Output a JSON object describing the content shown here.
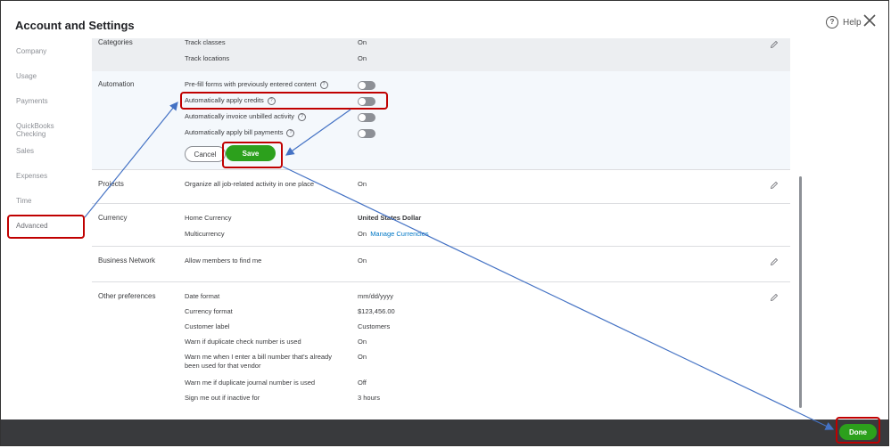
{
  "header": {
    "title": "Account and Settings",
    "help_label": "Help",
    "help_icon": "?"
  },
  "sidebar": {
    "items": [
      {
        "label": "Company"
      },
      {
        "label": "Usage"
      },
      {
        "label": "Payments"
      },
      {
        "label": "QuickBooks Checking"
      },
      {
        "label": "Sales"
      },
      {
        "label": "Expenses"
      },
      {
        "label": "Time"
      },
      {
        "label": "Advanced"
      }
    ]
  },
  "sections": {
    "categories": {
      "label": "Categories",
      "items": [
        {
          "label": "Track classes",
          "value": "On"
        },
        {
          "label": "Track locations",
          "value": "On"
        }
      ]
    },
    "automation": {
      "label": "Automation",
      "items": [
        {
          "label": "Pre-fill forms with previously entered content",
          "state": "off"
        },
        {
          "label": "Automatically apply credits",
          "state": "off"
        },
        {
          "label": "Automatically invoice unbilled activity",
          "state": "off"
        },
        {
          "label": "Automatically apply bill payments",
          "state": "off"
        }
      ],
      "cancel_label": "Cancel",
      "save_label": "Save"
    },
    "projects": {
      "label": "Projects",
      "item": {
        "label": "Organize all job-related activity in one place",
        "value": "On"
      }
    },
    "currency": {
      "label": "Currency",
      "items": [
        {
          "label": "Home Currency",
          "value": "United States Dollar"
        },
        {
          "label": "Multicurrency",
          "value": "On",
          "link": "Manage Currencies"
        }
      ]
    },
    "business_network": {
      "label": "Business Network",
      "item": {
        "label": "Allow members to find me",
        "value": "On"
      }
    },
    "other_preferences": {
      "label": "Other preferences",
      "items": [
        {
          "label": "Date format",
          "value": "mm/dd/yyyy"
        },
        {
          "label": "Currency format",
          "value": "$123,456.00"
        },
        {
          "label": "Customer label",
          "value": "Customers"
        },
        {
          "label": "Warn if duplicate check number is used",
          "value": "On"
        },
        {
          "label": "Warn me when I enter a bill number that's already",
          "label2": "been used for that vendor",
          "value": "On"
        },
        {
          "label": "Warn me if duplicate journal number is used",
          "value": "Off"
        },
        {
          "label": "Sign me out if inactive for",
          "value": "3 hours"
        }
      ]
    }
  },
  "footer": {
    "done_label": "Done"
  },
  "colors": {
    "accent_green": "#2ca01c",
    "annotation_red": "#c00000",
    "annotation_arrow": "#4472c4",
    "footer_bg": "#393a3d",
    "section_bg": "#eceef1",
    "automation_bg": "#f4f8fc"
  },
  "icons": {
    "help": "help-circle-icon",
    "close": "close-icon",
    "edit": "pencil-icon",
    "info": "question-circle-icon"
  }
}
